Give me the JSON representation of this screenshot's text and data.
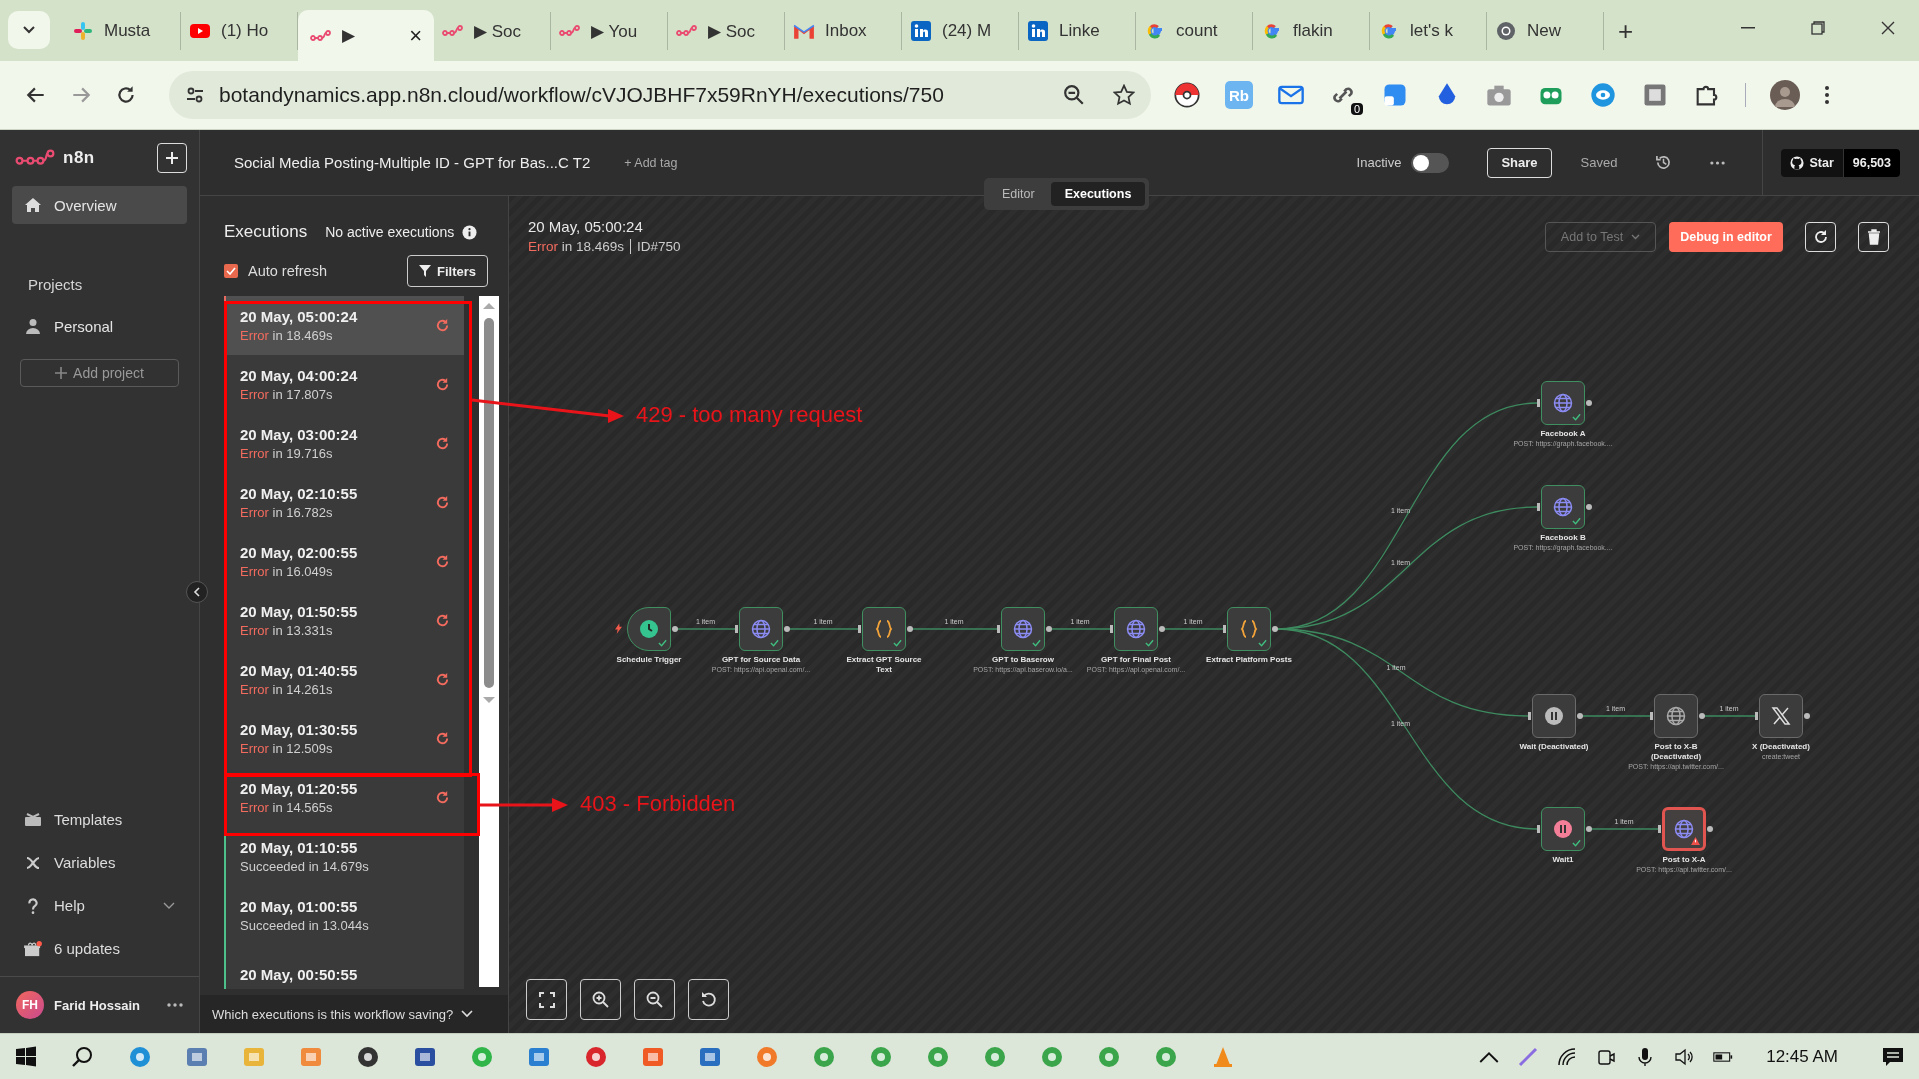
{
  "browser": {
    "tabs": [
      {
        "kind": "slack",
        "title": "Musta",
        "selected": false
      },
      {
        "kind": "youtube",
        "title": "(1) Ho",
        "selected": false
      },
      {
        "kind": "n8n",
        "title": "▶",
        "selected": true
      },
      {
        "kind": "n8n",
        "title": "▶ Soc",
        "selected": false
      },
      {
        "kind": "n8n",
        "title": "▶ You",
        "selected": false
      },
      {
        "kind": "n8n",
        "title": "▶ Soc",
        "selected": false
      },
      {
        "kind": "gmail",
        "title": "Inbox",
        "selected": false
      },
      {
        "kind": "linkedin",
        "title": "(24) M",
        "selected": false
      },
      {
        "kind": "linkedin",
        "title": "Linke",
        "selected": false
      },
      {
        "kind": "google",
        "title": "count",
        "selected": false
      },
      {
        "kind": "google",
        "title": "flakin",
        "selected": false
      },
      {
        "kind": "google",
        "title": "let's k",
        "selected": false
      },
      {
        "kind": "chrome",
        "title": "New",
        "selected": false
      }
    ],
    "close_label": "×",
    "new_tab": "+",
    "url": "botandynamics.app.n8n.cloud/workflow/cVJOJBHF7x59RnYH/executions/750",
    "extension_label": "Rb",
    "extension_badge": "0"
  },
  "sidebar": {
    "logo": "n8n",
    "items": [
      {
        "kind": "home",
        "label": "Overview",
        "selected": true
      }
    ],
    "projects_heading": "Projects",
    "projects": [
      {
        "label": "Personal",
        "selected": false
      }
    ],
    "add_project": "Add project",
    "bottom_items": [
      {
        "kind": "templates",
        "label": "Templates"
      },
      {
        "kind": "variables",
        "label": "Variables"
      },
      {
        "kind": "help",
        "label": "Help"
      },
      {
        "kind": "updates",
        "label": "6 updates"
      }
    ],
    "user": {
      "initials": "FH",
      "name": "Farid Hossain"
    }
  },
  "header": {
    "title": "Social Media Posting-Multiple ID - GPT for Bas...C T2",
    "add_tag": "+ Add tag",
    "active_label": "Inactive",
    "active": false,
    "share": "Share",
    "saved": "Saved",
    "github": {
      "label": "Star",
      "count": "96,503"
    }
  },
  "view_tabs": [
    {
      "label": "Editor",
      "selected": false
    },
    {
      "label": "Executions",
      "selected": true
    }
  ],
  "executions_panel": {
    "title": "Executions",
    "status": "No active executions",
    "auto_refresh": {
      "label": "Auto refresh",
      "checked": true
    },
    "filters": "Filters",
    "items": [
      {
        "time": "20 May, 05:00:24",
        "kind": "error",
        "status": "Error",
        "duration": "in 18.469s",
        "selected": true
      },
      {
        "time": "20 May, 04:00:24",
        "kind": "error",
        "status": "Error",
        "duration": "in 17.807s",
        "selected": false
      },
      {
        "time": "20 May, 03:00:24",
        "kind": "error",
        "status": "Error",
        "duration": "in 19.716s",
        "selected": false
      },
      {
        "time": "20 May, 02:10:55",
        "kind": "error",
        "status": "Error",
        "duration": "in 16.782s",
        "selected": false
      },
      {
        "time": "20 May, 02:00:55",
        "kind": "error",
        "status": "Error",
        "duration": "in 16.049s",
        "selected": false
      },
      {
        "time": "20 May, 01:50:55",
        "kind": "error",
        "status": "Error",
        "duration": "in 13.331s",
        "selected": false
      },
      {
        "time": "20 May, 01:40:55",
        "kind": "error",
        "status": "Error",
        "duration": "in 14.261s",
        "selected": false
      },
      {
        "time": "20 May, 01:30:55",
        "kind": "error",
        "status": "Error",
        "duration": "in 12.509s",
        "selected": false
      },
      {
        "time": "20 May, 01:20:55",
        "kind": "error",
        "status": "Error",
        "duration": "in 14.565s",
        "selected": false
      },
      {
        "time": "20 May, 01:10:55",
        "kind": "success",
        "status": "Succeeded",
        "duration": "in 14.679s",
        "selected": false
      },
      {
        "time": "20 May, 01:00:55",
        "kind": "success",
        "status": "Succeeded",
        "duration": "in 13.044s",
        "selected": false
      },
      {
        "time": "20 May, 00:50:55",
        "kind": "success",
        "selected": false
      }
    ],
    "footer": "Which executions is this workflow saving?"
  },
  "execution_detail": {
    "time": "20 May, 05:00:24",
    "kind": "error",
    "status": "Error",
    "duration": "in 18.469s",
    "id": "ID#750",
    "add_to_test": "Add to Test",
    "debug": "Debug in editor"
  },
  "workflow": {
    "nodes": [
      {
        "label": "Schedule Trigger",
        "kind": "trigger",
        "succeeded": true,
        "disabled": false,
        "failed": false
      },
      {
        "label": "GPT for Source Data",
        "subtitle": "POST: https://api.openai.com/...",
        "kind": "http",
        "succeeded": true,
        "disabled": false,
        "failed": false
      },
      {
        "label": "Extract GPT Source Text",
        "kind": "code",
        "succeeded": true,
        "disabled": false,
        "failed": false
      },
      {
        "label": "GPT to Baserow",
        "subtitle": "POST: https://api.baserow.io/a...",
        "kind": "http",
        "succeeded": true,
        "disabled": false,
        "failed": false
      },
      {
        "label": "GPT for Final Post",
        "subtitle": "POST: https://api.openai.com/...",
        "kind": "http",
        "succeeded": true,
        "disabled": false,
        "failed": false
      },
      {
        "label": "Extract Platform Posts",
        "kind": "code",
        "succeeded": true,
        "disabled": false,
        "failed": false
      },
      {
        "label": "Facebook A",
        "subtitle": "POST: https://graph.facebook....",
        "kind": "http",
        "succeeded": true,
        "disabled": false,
        "failed": false
      },
      {
        "label": "Facebook B",
        "subtitle": "POST: https://graph.facebook....",
        "kind": "http",
        "succeeded": true,
        "disabled": false,
        "failed": false
      },
      {
        "label": "Wait (Deactivated)",
        "kind": "wait",
        "succeeded": false,
        "disabled": true,
        "failed": false
      },
      {
        "label": "Post to X-B (Deactivated)",
        "subtitle": "POST: https://api.twitter.com/...",
        "kind": "http",
        "succeeded": false,
        "disabled": true,
        "failed": false
      },
      {
        "label": "X (Deactivated)",
        "subtitle": "create:tweet",
        "kind": "x",
        "succeeded": false,
        "disabled": true,
        "failed": false
      },
      {
        "label": "Wait1",
        "kind": "wait",
        "succeeded": true,
        "disabled": false,
        "failed": false
      },
      {
        "label": "Post to X-A",
        "subtitle": "POST: https://api.twitter.com/...",
        "kind": "http",
        "succeeded": false,
        "disabled": false,
        "failed": true
      }
    ],
    "edges": [
      {
        "label": "1 item"
      },
      {
        "label": "1 item"
      },
      {
        "label": "1 item"
      },
      {
        "label": "1 item"
      },
      {
        "label": "1 item"
      },
      {
        "label": "1 item"
      },
      {
        "label": "1 item"
      },
      {
        "label": "1 item"
      },
      {
        "label": "1 item"
      },
      {
        "label": "1 item"
      },
      {
        "label": "1 item"
      },
      {
        "label": "1 item"
      }
    ]
  },
  "annotations": [
    {
      "text": "429 - too many request"
    },
    {
      "text": "403 - Forbidden"
    }
  ],
  "taskbar": {
    "clock": "12:45 AM"
  }
}
